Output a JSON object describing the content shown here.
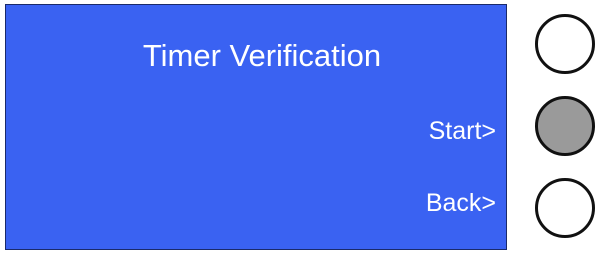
{
  "screen": {
    "title": "Timer Verification",
    "background_color": "#3a62f2",
    "text_color": "#ffffff"
  },
  "softkeys": [
    {
      "label": "Start>"
    },
    {
      "label": "Back>"
    }
  ],
  "hardware_buttons": [
    {
      "name": "top",
      "state": "released",
      "color": "#ffffff"
    },
    {
      "name": "middle",
      "state": "pressed",
      "color": "#9a9a9a"
    },
    {
      "name": "bottom",
      "state": "released",
      "color": "#ffffff"
    }
  ]
}
